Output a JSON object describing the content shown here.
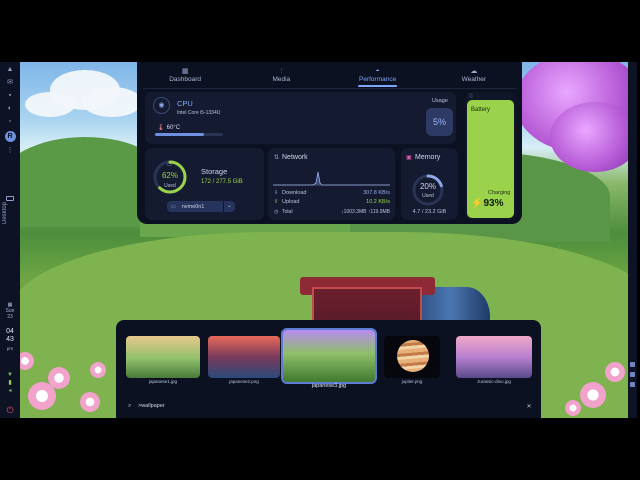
{
  "tabs": [
    {
      "label": "Dashboard",
      "icon": "grid-icon"
    },
    {
      "label": "Media",
      "icon": "sliders-icon"
    },
    {
      "label": "Performance",
      "icon": "gauge-icon",
      "active": true
    },
    {
      "label": "Weather",
      "icon": "cloud-icon"
    }
  ],
  "cpu": {
    "title": "CPU",
    "model": "Intel Core i5-1334U",
    "temperature": "60°C",
    "temp_level": 0.72,
    "usage_label": "Usage",
    "usage_value": "5%"
  },
  "battery": {
    "title": "Battery",
    "status": "Charging",
    "percent": "93%",
    "level": 0.93,
    "color": "#9ad34b"
  },
  "storage": {
    "title": "Storage",
    "percent": "62%",
    "used_label": "Used",
    "value": "172 / 277.5 GiB",
    "drive": "nvme0n1",
    "level": 0.62
  },
  "network": {
    "title": "Network",
    "download_label": "Download",
    "download_value": "307.8 KB/s",
    "upload_label": "Upload",
    "upload_value": "10.2 KB/s",
    "total_label": "Total",
    "total_value": "↓1003.3MB ↑119.9MB"
  },
  "memory": {
    "title": "Memory",
    "percent": "20%",
    "used_label": "Used",
    "value": "4.7 / 23.2 GiB",
    "level": 0.2
  },
  "sidebar": {
    "desktop_label": "Desktop",
    "date_day": "Sun",
    "date_num": "23",
    "time_hours": "04",
    "time_minutes": "43",
    "time_ampm": "pm"
  },
  "picker": {
    "items": [
      {
        "label": "japanese1.jpg"
      },
      {
        "label": "japanese2.png"
      },
      {
        "label": "japanese3.jpg",
        "selected": true
      },
      {
        "label": "jupiter.png"
      },
      {
        "label": "Jurassic-dino.jpg"
      }
    ],
    "search_value": ">wallpaper"
  },
  "colors": {
    "accent": "#7ea6ff",
    "green": "#9ad34b",
    "panel": "#0b1120",
    "card": "#141b30"
  }
}
